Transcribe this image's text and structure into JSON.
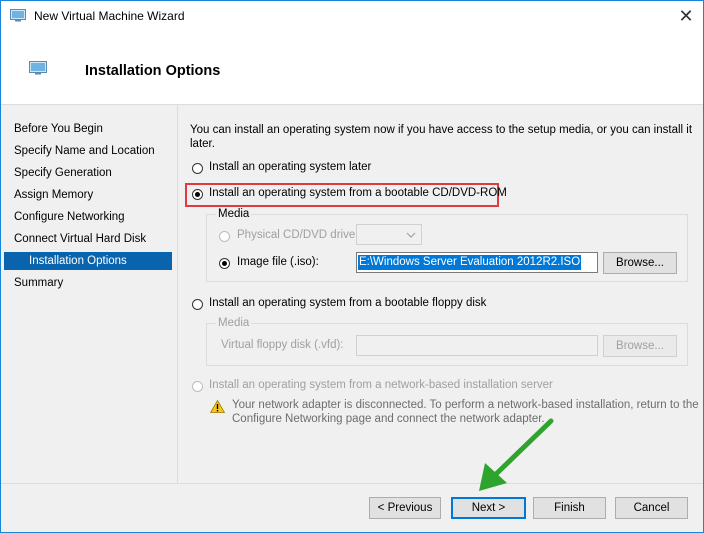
{
  "window": {
    "title": "New Virtual Machine Wizard",
    "close_glyph": "✕"
  },
  "header": {
    "title": "Installation Options",
    "icon": "vm-monitor-icon"
  },
  "nav": {
    "items": [
      {
        "label": "Before You Begin"
      },
      {
        "label": "Specify Name and Location"
      },
      {
        "label": "Specify Generation"
      },
      {
        "label": "Assign Memory"
      },
      {
        "label": "Configure Networking"
      },
      {
        "label": "Connect Virtual Hard Disk"
      },
      {
        "label": "Installation Options",
        "active": true
      },
      {
        "label": "Summary"
      }
    ]
  },
  "content": {
    "intro_line1": "You can install an operating system now if you have access to the setup media, or you can install it",
    "intro_line2": "later.",
    "options": {
      "later": "Install an operating system later",
      "cd_dvd": "Install an operating system from a bootable CD/DVD-ROM",
      "floppy": "Install an operating system from a bootable floppy disk",
      "network": "Install an operating system from a network-based installation server"
    },
    "selected_option": "cd_dvd",
    "media_cd": {
      "legend": "Media",
      "physical_label": "Physical CD/DVD drive:",
      "image_label": "Image file (.iso):",
      "image_value": "E:\\Windows Server Evaluation 2012R2.ISO",
      "browse": "Browse..."
    },
    "media_floppy": {
      "legend": "Media",
      "vfd_label": "Virtual floppy disk (.vfd):",
      "browse": "Browse..."
    },
    "warning_line1": "Your network adapter is disconnected. To perform a network-based installation, return to the",
    "warning_line2": "Configure Networking page and connect the network adapter."
  },
  "buttons": {
    "previous": "< Previous",
    "next": "Next >",
    "finish": "Finish",
    "cancel": "Cancel"
  },
  "colors": {
    "accent": "#0a64ad",
    "highlight_box": "#e0393e",
    "arrow": "#2ea42e"
  }
}
